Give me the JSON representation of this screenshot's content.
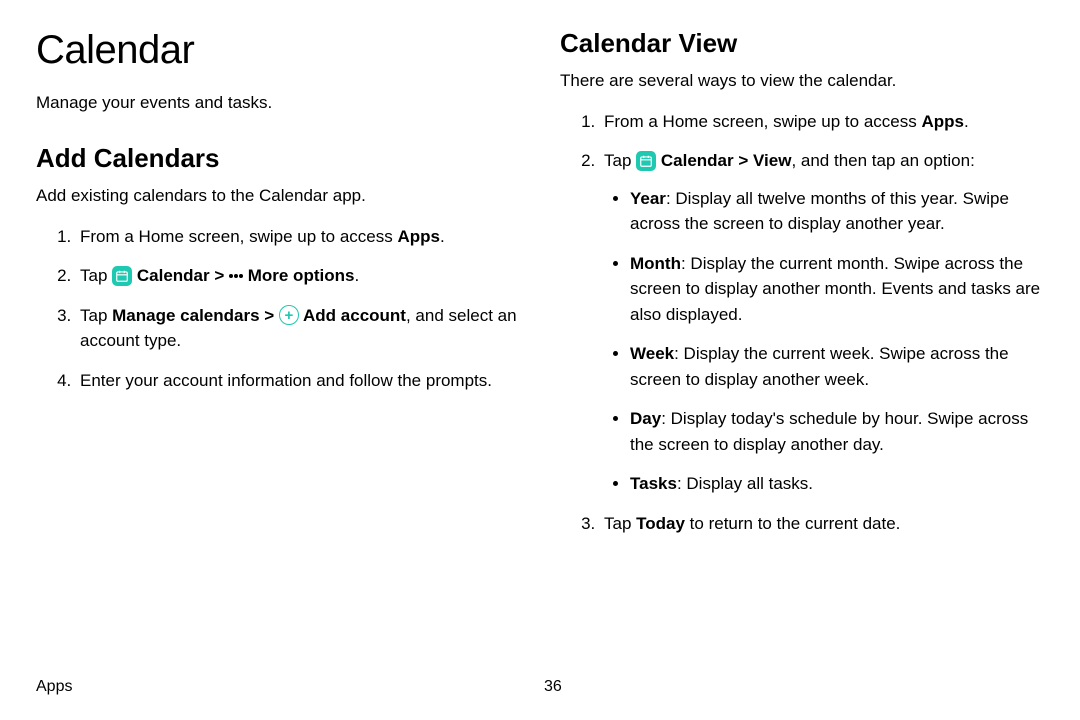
{
  "left": {
    "main_title": "Calendar",
    "subtitle": "Manage your events and tasks.",
    "section_title": "Add Calendars",
    "desc": "Add existing calendars to the Calendar app.",
    "step1_a": "From a Home screen, swipe up to access ",
    "step1_b": "Apps",
    "step1_c": ".",
    "step2_a": "Tap ",
    "step2_b": " Calendar",
    "step2_c": " > ",
    "step2_d": " More options",
    "step2_e": ".",
    "step3_a": "Tap ",
    "step3_b": "Manage calendars",
    "step3_c": " > ",
    "step3_d": " Add account",
    "step3_e": ", and select an account type.",
    "step4": "Enter your account information and follow the prompts."
  },
  "right": {
    "section_title": "Calendar View",
    "desc": "There are several ways to view the calendar.",
    "step1_a": "From a Home screen, swipe up to access ",
    "step1_b": "Apps",
    "step1_c": ".",
    "step2_a": "Tap ",
    "step2_b": " Calendar",
    "step2_c": " > ",
    "step2_d": "View",
    "step2_e": ", and then tap an option:",
    "b1_a": "Year",
    "b1_b": ": Display all twelve months of this year. Swipe across the screen to display another year.",
    "b2_a": "Month",
    "b2_b": ": Display the current month. Swipe across the screen to display another month. Events and tasks are also displayed.",
    "b3_a": "Week",
    "b3_b": ": Display the current week. Swipe across the screen to display another week.",
    "b4_a": "Day",
    "b4_b": ": Display today's schedule by hour. Swipe across the screen to display another day.",
    "b5_a": "Tasks",
    "b5_b": ": Display all tasks.",
    "step3_a": "Tap ",
    "step3_b": "Today",
    "step3_c": " to return to the current date."
  },
  "footer": {
    "label": "Apps",
    "page": "36"
  }
}
